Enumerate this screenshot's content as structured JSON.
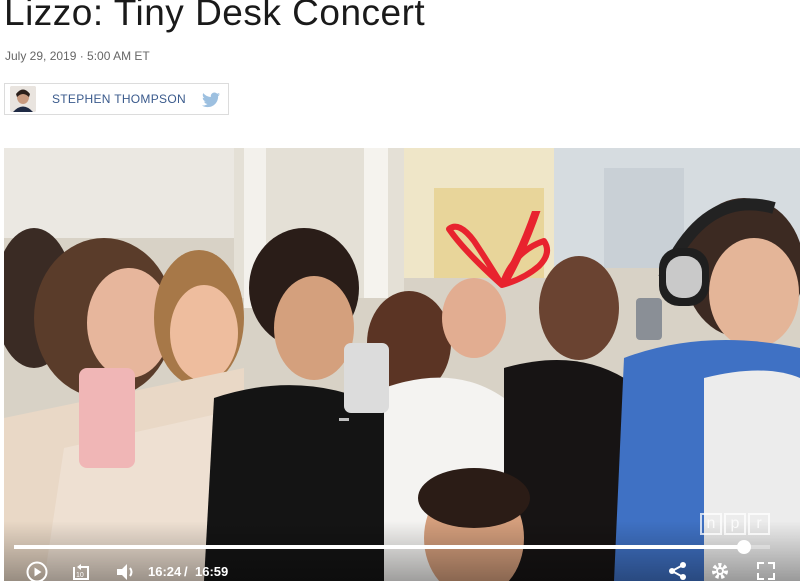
{
  "article": {
    "title": "Lizzo: Tiny Desk Concert",
    "date": "July 29, 2019 · 5:00 AM ET",
    "author": "STEPHEN THOMPSON"
  },
  "icons": {
    "twitter": "twitter-icon",
    "play": "play-icon",
    "rewind": "rewind-10-icon",
    "volume": "volume-icon",
    "share": "share-icon",
    "settings": "gear-icon",
    "fullscreen": "fullscreen-icon"
  },
  "player": {
    "current_time": "16:24",
    "separator": "/",
    "duration": "16:59",
    "progress": 0.966,
    "watermark": [
      "n",
      "p",
      "r"
    ]
  },
  "colors": {
    "author_link": "#3a5a8c",
    "twitter": "#9dc0e0",
    "annotation_arrow": "#e8232e"
  }
}
